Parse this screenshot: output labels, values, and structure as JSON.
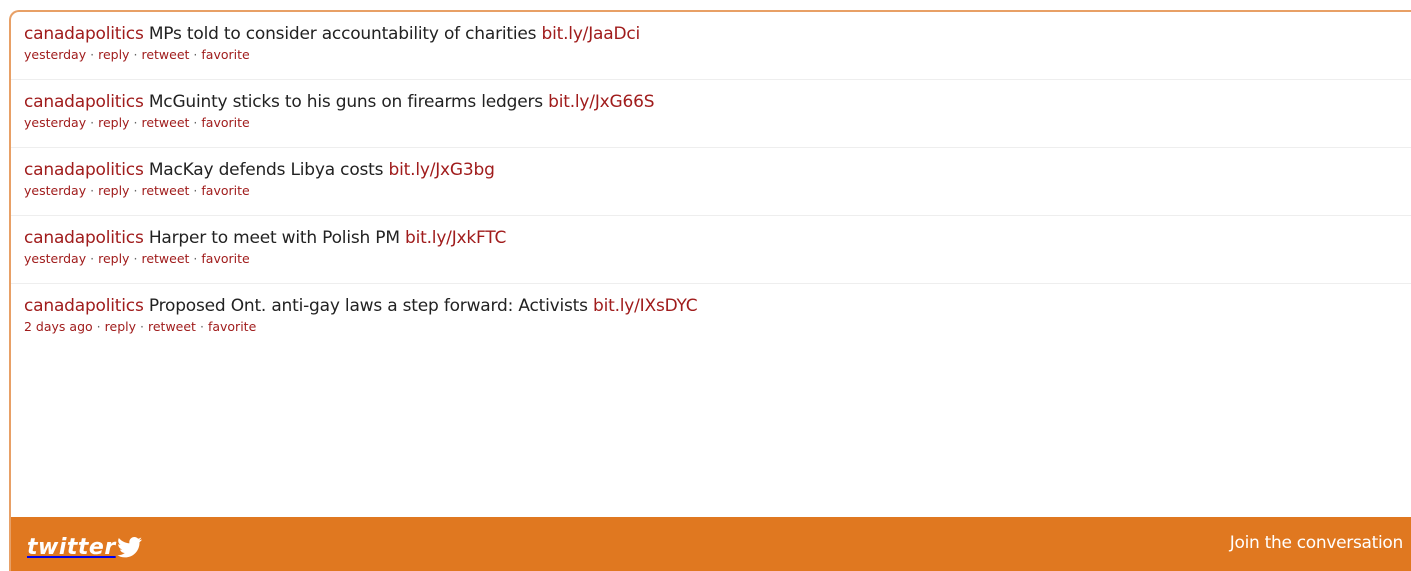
{
  "tweets": [
    {
      "user": "canadapolitics",
      "text": "MPs told to consider accountability of charities",
      "link": "bit.ly/JaaDci",
      "time": "yesterday",
      "reply": "reply",
      "retweet": "retweet",
      "favorite": "favorite"
    },
    {
      "user": "canadapolitics",
      "text": "McGuinty sticks to his guns on firearms ledgers",
      "link": "bit.ly/JxG66S",
      "time": "yesterday",
      "reply": "reply",
      "retweet": "retweet",
      "favorite": "favorite"
    },
    {
      "user": "canadapolitics",
      "text": "MacKay defends Libya costs",
      "link": "bit.ly/JxG3bg",
      "time": "yesterday",
      "reply": "reply",
      "retweet": "retweet",
      "favorite": "favorite"
    },
    {
      "user": "canadapolitics",
      "text": "Harper to meet with Polish PM",
      "link": "bit.ly/JxkFTC",
      "time": "yesterday",
      "reply": "reply",
      "retweet": "retweet",
      "favorite": "favorite"
    },
    {
      "user": "canadapolitics",
      "text": "Proposed Ont. anti-gay laws a step forward: Activists",
      "link": "bit.ly/IXsDYC",
      "time": "2 days ago",
      "reply": "reply",
      "retweet": "retweet",
      "favorite": "favorite"
    }
  ],
  "footer": {
    "logo_text": "twitter",
    "logo_icon": "bird-icon",
    "join_label": "Join the conversation",
    "background": "#e07820"
  },
  "colors": {
    "accent": "#a01c1c",
    "border": "#e8a066"
  }
}
